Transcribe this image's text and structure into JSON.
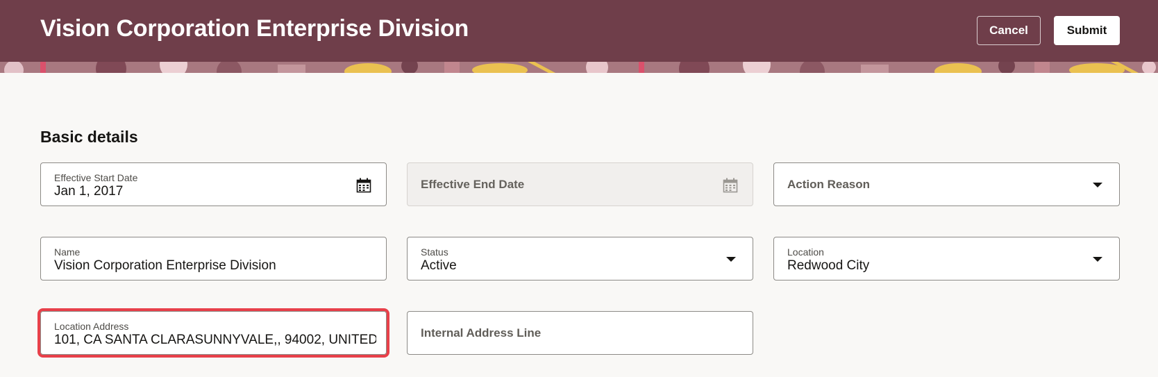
{
  "header": {
    "title": "Vision Corporation Enterprise Division",
    "cancel_label": "Cancel",
    "submit_label": "Submit",
    "bg_color": "#6f3e4a"
  },
  "section": {
    "title": "Basic details"
  },
  "fields": {
    "effective_start_date": {
      "label": "Effective Start Date",
      "value": "Jan 1, 2017",
      "icon": "calendar-icon"
    },
    "effective_end_date": {
      "label": "Effective End Date",
      "value": "",
      "icon": "calendar-icon",
      "disabled": true
    },
    "action_reason": {
      "label": "Action Reason",
      "value": "",
      "icon": "chevron-down-icon"
    },
    "name": {
      "label": "Name",
      "value": "Vision Corporation Enterprise Division"
    },
    "status": {
      "label": "Status",
      "value": "Active",
      "icon": "chevron-down-icon"
    },
    "location": {
      "label": "Location",
      "value": "Redwood City",
      "icon": "chevron-down-icon"
    },
    "location_address": {
      "label": "Location Address",
      "value": "101, CA SANTA CLARASUNNYVALE,, 94002, UNITED"
    },
    "internal_address_line": {
      "label": "Internal Address Line",
      "value": ""
    }
  },
  "colors": {
    "highlight": "#e8404a",
    "accent": "#6f3e4a"
  }
}
